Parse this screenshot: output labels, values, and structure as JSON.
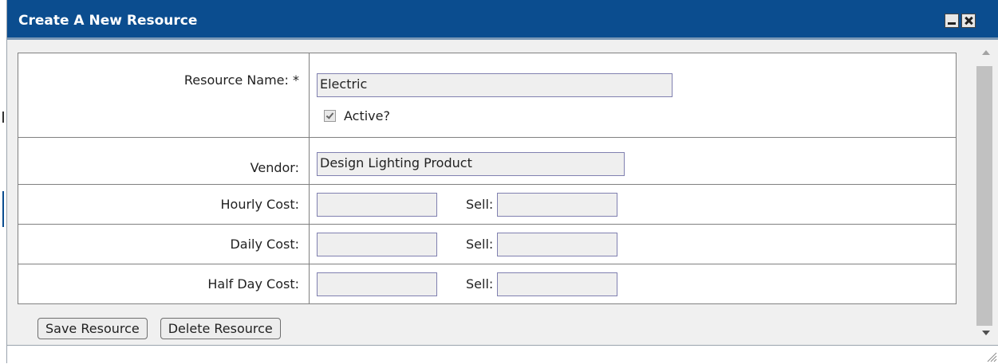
{
  "dialog": {
    "title": "Create A New Resource",
    "minimize_icon": "minimize-icon",
    "close_icon": "close-icon"
  },
  "form": {
    "resource_name": {
      "label": "Resource Name: *",
      "value": "Electric"
    },
    "active": {
      "label": "Active?",
      "checked": true
    },
    "vendor": {
      "label": "Vendor:",
      "value": "Design Lighting Product"
    },
    "hourly": {
      "label": "Hourly Cost:",
      "value": "",
      "sell_label": "Sell:",
      "sell_value": ""
    },
    "daily": {
      "label": "Daily Cost:",
      "value": "",
      "sell_label": "Sell:",
      "sell_value": ""
    },
    "half_day": {
      "label": "Half Day Cost:",
      "value": "",
      "sell_label": "Sell:",
      "sell_value": ""
    }
  },
  "buttons": {
    "save": "Save Resource",
    "delete": "Delete Resource"
  },
  "colors": {
    "titlebar": "#0b4d8f",
    "title_text": "#ffffff",
    "panel_background": "#f0f0f0"
  }
}
